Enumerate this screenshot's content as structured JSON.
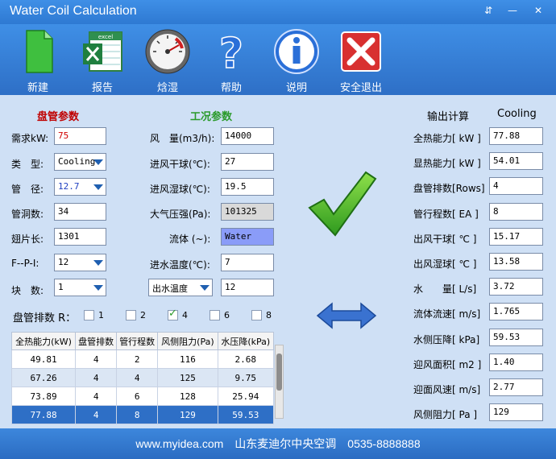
{
  "window": {
    "title": "Water Coil Calculation",
    "btn_pin": "⇵",
    "btn_min": "—",
    "btn_close": "✕"
  },
  "toolbar": [
    "新建",
    "报告",
    "焓湿",
    "帮助",
    "说明",
    "安全退出"
  ],
  "excel_text": "excel",
  "coil": {
    "title": "盘管参数",
    "title_color": "#c00000",
    "rows": [
      {
        "label": "需求kW:",
        "value": "75",
        "value_color": "#d00000"
      },
      {
        "label": "类　型:",
        "value": "Cooling"
      },
      {
        "label": "管　径:",
        "value": "12.7",
        "value_color": "#1f3fc0"
      },
      {
        "label": "管洞数:",
        "value": "34"
      },
      {
        "label": "翅片长:",
        "value": "1301"
      },
      {
        "label": "F--P-I:",
        "value": "12"
      },
      {
        "label": "块　数:",
        "value": "1"
      }
    ]
  },
  "work": {
    "title": "工况参数",
    "title_color": "#2a9a2a",
    "rows": [
      {
        "label": "风　量(m3/h):",
        "value": "14000"
      },
      {
        "label": "进风干球(℃):",
        "value": "27"
      },
      {
        "label": "进风湿球(℃):",
        "value": "19.5"
      },
      {
        "label": "大气压强(Pa):",
        "value": "101325"
      },
      {
        "label": "流体 (~):",
        "value": "Water"
      },
      {
        "label": "进水温度(℃):",
        "value": "7"
      },
      {
        "label": "出水温度",
        "value": "12"
      }
    ]
  },
  "rows_label": "盘管排数 R：",
  "rows_options": [
    {
      "label": "1",
      "checked": false
    },
    {
      "label": "2",
      "checked": false
    },
    {
      "label": "4",
      "checked": true
    },
    {
      "label": "6",
      "checked": false
    },
    {
      "label": "8",
      "checked": false
    }
  ],
  "table": {
    "headers": [
      "全热能力(kW)",
      "盘管排数",
      "管行程数",
      "风侧阻力(Pa)",
      "水压降(kPa)"
    ],
    "rows": [
      [
        "49.81",
        "4",
        "2",
        "116",
        "2.68"
      ],
      [
        "67.26",
        "4",
        "4",
        "125",
        "9.75"
      ],
      [
        "73.89",
        "4",
        "6",
        "128",
        "25.94"
      ],
      [
        "77.88",
        "4",
        "8",
        "129",
        "59.53"
      ]
    ],
    "selected_row": 3
  },
  "output": {
    "title": "输出计算",
    "mode": "Cooling",
    "rows": [
      {
        "label": "全热能力[ kW ]",
        "value": "77.88"
      },
      {
        "label": "显热能力[ kW ]",
        "value": "54.01"
      },
      {
        "label": "盘管排数[Rows]",
        "value": "4"
      },
      {
        "label": "管行程数[ EA ]",
        "value": "8"
      },
      {
        "label": "出风干球[ ℃ ]",
        "value": "15.17"
      },
      {
        "label": "出风湿球[ ℃ ]",
        "value": "13.58"
      },
      {
        "label": "水　　量[ L/s]",
        "value": "3.72"
      },
      {
        "label": "流体流速[ m/s]",
        "value": "1.765"
      },
      {
        "label": "水侧压降[ kPa]",
        "value": "59.53"
      },
      {
        "label": "迎风面积[ m2 ]",
        "value": "1.40"
      },
      {
        "label": "迎面风速[ m/s]",
        "value": "2.77"
      },
      {
        "label": "风侧阻力[ Pa ]",
        "value": "129"
      }
    ]
  },
  "footer": "www.myidea.com　山东麦迪尔中央空调　0535-8888888"
}
